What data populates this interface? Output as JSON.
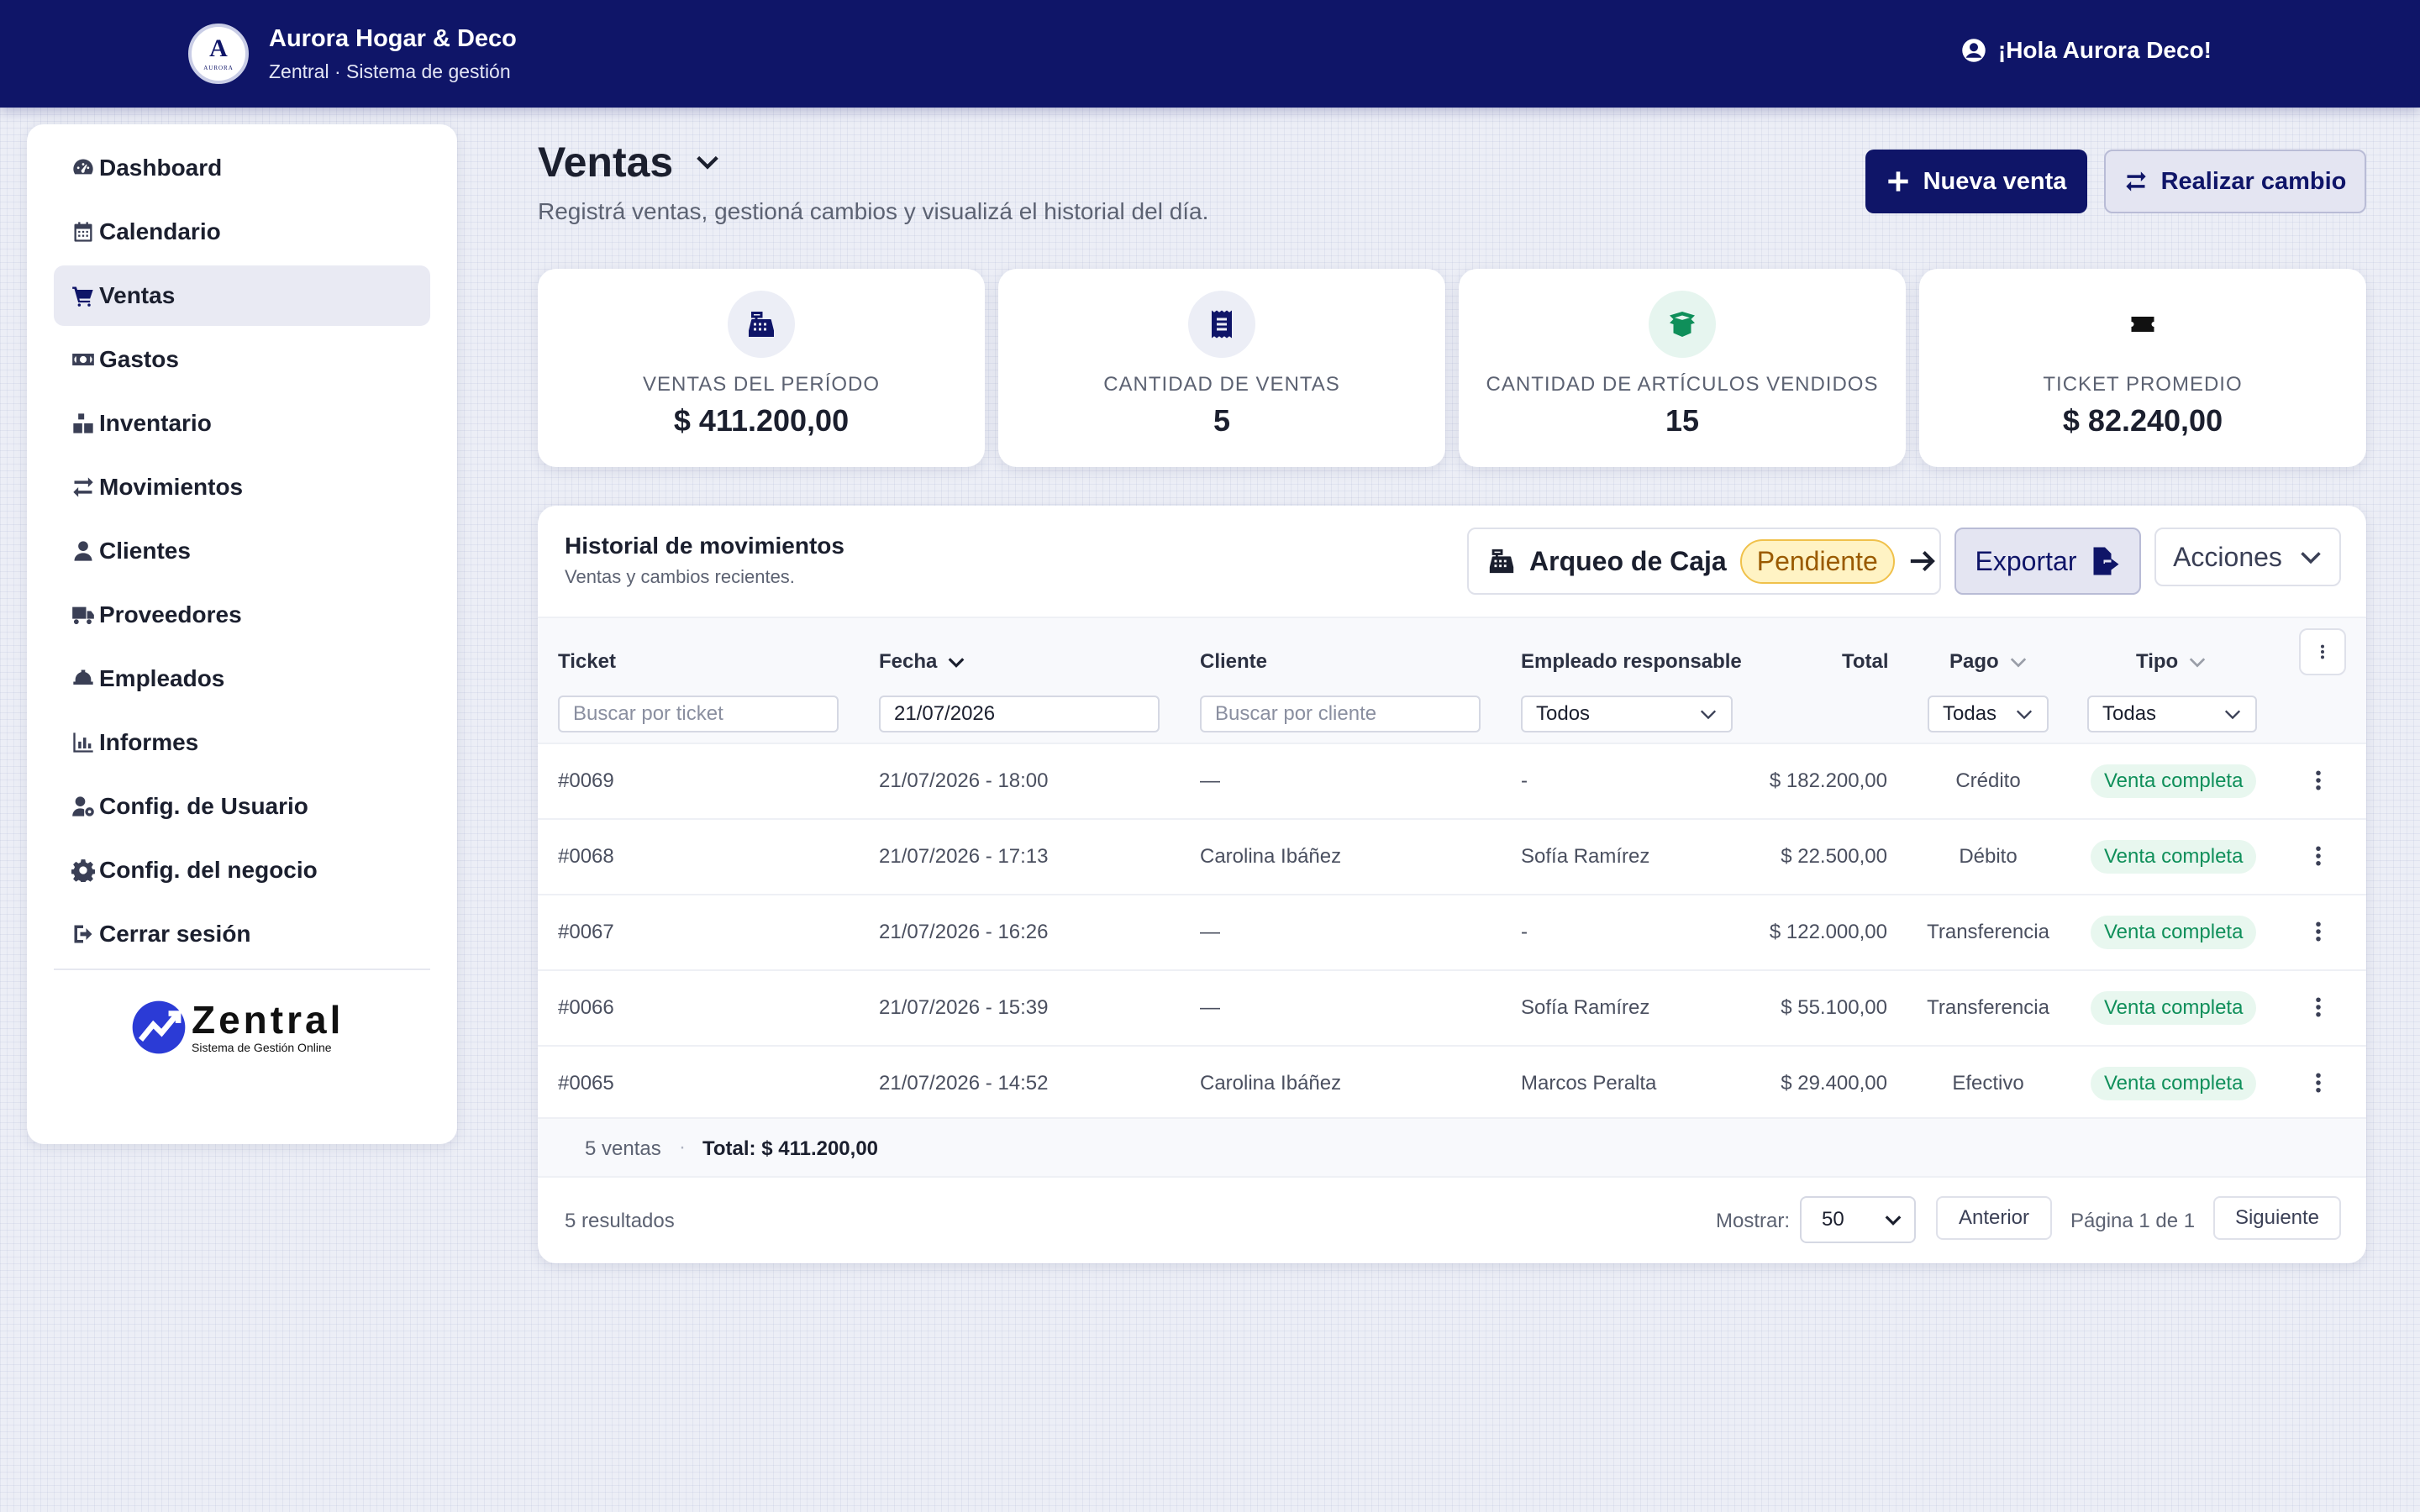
{
  "header": {
    "logo_letter": "A",
    "logo_sub": "AURORA",
    "brand_name": "Aurora Hogar & Deco",
    "brand_sub": "Zentral · Sistema de gestión",
    "greeting": "¡Hola Aurora Deco!"
  },
  "sidebar": {
    "items": [
      {
        "label": "Dashboard",
        "icon": "gauge-icon"
      },
      {
        "label": "Calendario",
        "icon": "calendar-icon"
      },
      {
        "label": "Ventas",
        "icon": "cart-icon",
        "active": true
      },
      {
        "label": "Gastos",
        "icon": "money-icon"
      },
      {
        "label": "Inventario",
        "icon": "boxes-icon"
      },
      {
        "label": "Movimientos",
        "icon": "arrows-icon"
      },
      {
        "label": "Clientes",
        "icon": "user-icon"
      },
      {
        "label": "Proveedores",
        "icon": "truck-icon"
      },
      {
        "label": "Empleados",
        "icon": "helmet-icon"
      },
      {
        "label": "Informes",
        "icon": "chart-icon"
      },
      {
        "label": "Config. de Usuario",
        "icon": "user-gear-icon"
      },
      {
        "label": "Config. del negocio",
        "icon": "gear-icon"
      },
      {
        "label": "Cerrar sesión",
        "icon": "logout-icon"
      }
    ],
    "logo_word": "Zentral",
    "logo_tag": "Sistema de Gestión Online"
  },
  "page": {
    "title": "Ventas",
    "subtitle": "Registrá ventas, gestioná cambios y visualizá el historial del día.",
    "new_sale": "Nueva venta",
    "exchange": "Realizar cambio"
  },
  "stats": [
    {
      "label": "VENTAS DEL PERÍODO",
      "value": "$ 411.200,00",
      "icon": "cash-register-icon"
    },
    {
      "label": "CANTIDAD DE VENTAS",
      "value": "5",
      "icon": "receipt-icon"
    },
    {
      "label": "CANTIDAD DE ARTÍCULOS VENDIDOS",
      "value": "15",
      "icon": "box-open-icon"
    },
    {
      "label": "TICKET PROMEDIO",
      "value": "$ 82.240,00",
      "icon": "ticket-icon"
    }
  ],
  "history": {
    "title": "Historial de movimientos",
    "subtitle": "Ventas y cambios recientes.",
    "arqueo_label": "Arqueo de Caja",
    "arqueo_status": "Pendiente",
    "export_label": "Exportar",
    "actions_label": "Acciones",
    "columns": {
      "ticket": "Ticket",
      "fecha": "Fecha",
      "cliente": "Cliente",
      "empleado": "Empleado responsable",
      "total": "Total",
      "pago": "Pago",
      "tipo": "Tipo"
    },
    "filters": {
      "ticket_placeholder": "Buscar por ticket",
      "fecha_value": "21/07/2026",
      "cliente_placeholder": "Buscar por cliente",
      "empleado_value": "Todos",
      "pago_value": "Todas",
      "tipo_value": "Todas"
    },
    "rows": [
      {
        "ticket": "#0069",
        "fecha": "21/07/2026 - 18:00",
        "cliente": "—",
        "empleado": "-",
        "total": "$ 182.200,00",
        "pago": "Crédito",
        "tipo": "Venta completa"
      },
      {
        "ticket": "#0068",
        "fecha": "21/07/2026 - 17:13",
        "cliente": "Carolina Ibáñez",
        "empleado": "Sofía Ramírez",
        "total": "$ 22.500,00",
        "pago": "Débito",
        "tipo": "Venta completa"
      },
      {
        "ticket": "#0067",
        "fecha": "21/07/2026 - 16:26",
        "cliente": "—",
        "empleado": "-",
        "total": "$ 122.000,00",
        "pago": "Transferencia",
        "tipo": "Venta completa"
      },
      {
        "ticket": "#0066",
        "fecha": "21/07/2026 - 15:39",
        "cliente": "—",
        "empleado": "Sofía Ramírez",
        "total": "$ 55.100,00",
        "pago": "Transferencia",
        "tipo": "Venta completa"
      },
      {
        "ticket": "#0065",
        "fecha": "21/07/2026 - 14:52",
        "cliente": "Carolina Ibáñez",
        "empleado": "Marcos Peralta",
        "total": "$ 29.400,00",
        "pago": "Efectivo",
        "tipo": "Venta completa"
      }
    ],
    "summary_count": "5 ventas",
    "summary_dot": "·",
    "summary_total": "Total: $ 411.200,00",
    "results": "5 resultados",
    "show_label": "Mostrar:",
    "page_size": "50",
    "prev_label": "Anterior",
    "page_info": "Página 1 de 1",
    "next_label": "Siguiente"
  },
  "colors": {
    "brand": "#0f1568",
    "success": "#0f8f5a",
    "pending": "#f0c14b"
  }
}
